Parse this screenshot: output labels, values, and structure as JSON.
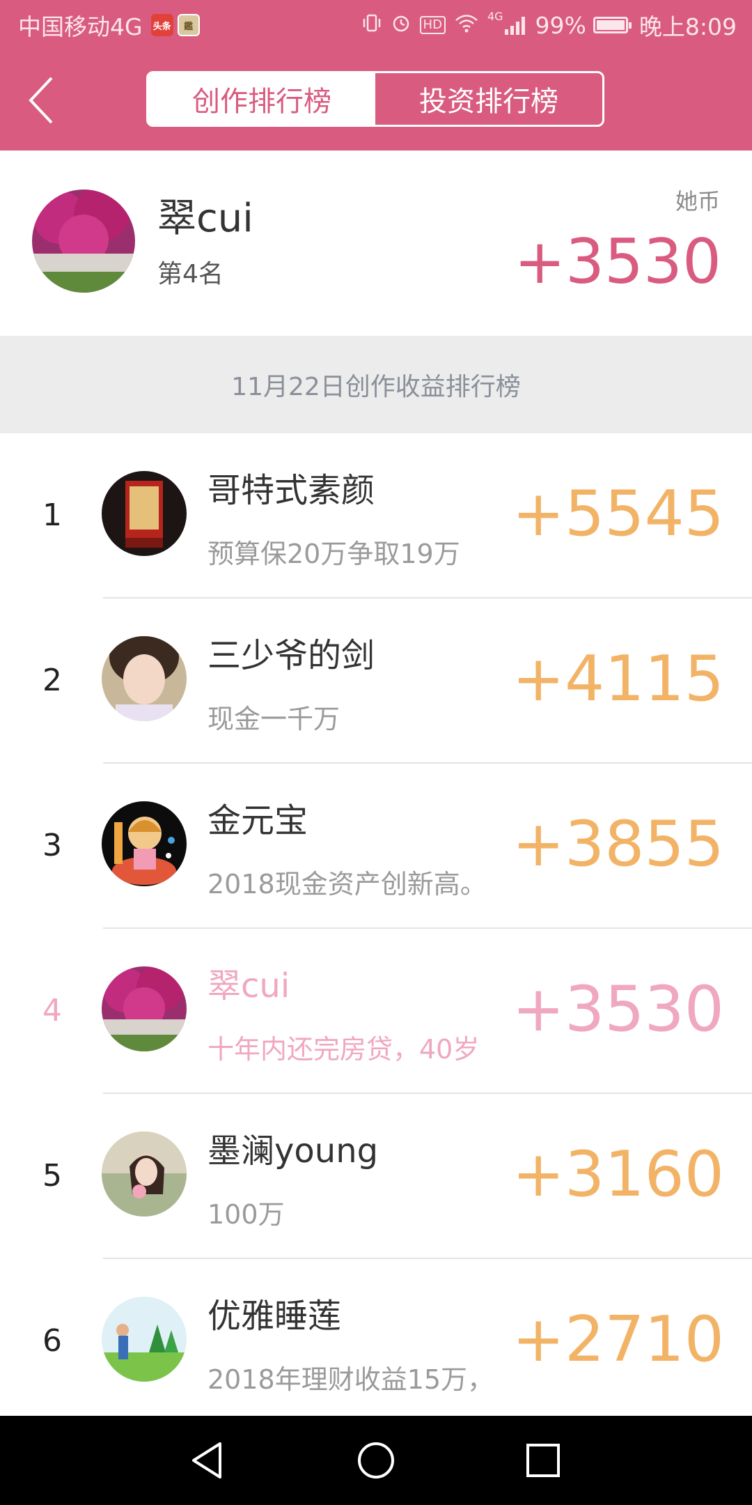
{
  "status_bar": {
    "carrier": "中国移动4G",
    "app_badge_1": "头条",
    "app_badge_2": "鑑",
    "hd_label": "HD",
    "network": "4G",
    "battery_text": "99%",
    "battery_level": 0.99,
    "time": "晚上8:09"
  },
  "header": {
    "tabs": [
      {
        "label": "创作排行榜",
        "active": true
      },
      {
        "label": "投资排行榜",
        "active": false
      }
    ]
  },
  "me": {
    "name": "翠cui",
    "rank": "第4名",
    "unit": "她币",
    "score": "+3530"
  },
  "section": {
    "title": "11月22日创作收益排行榜"
  },
  "rows": [
    {
      "rank": "1",
      "name": "哥特式素颜",
      "desc": "预算保20万争取19万",
      "score": "+5545"
    },
    {
      "rank": "2",
      "name": "三少爷的剑",
      "desc": "现金一千万",
      "score": "+4115"
    },
    {
      "rank": "3",
      "name": "金元宝",
      "desc": "2018现金资产创新高。",
      "score": "+3855"
    },
    {
      "rank": "4",
      "name": "翠cui",
      "desc": "十年内还完房贷，40岁",
      "score": "+3530"
    },
    {
      "rank": "5",
      "name": "墨澜young",
      "desc": "100万",
      "score": "+3160"
    },
    {
      "rank": "6",
      "name": "优雅睡莲",
      "desc": "2018年理财收益15万，",
      "score": "+2710"
    }
  ],
  "colors": {
    "brand": "#d95b80",
    "score": "#f2b367",
    "highlight": "#f0a7c0"
  }
}
